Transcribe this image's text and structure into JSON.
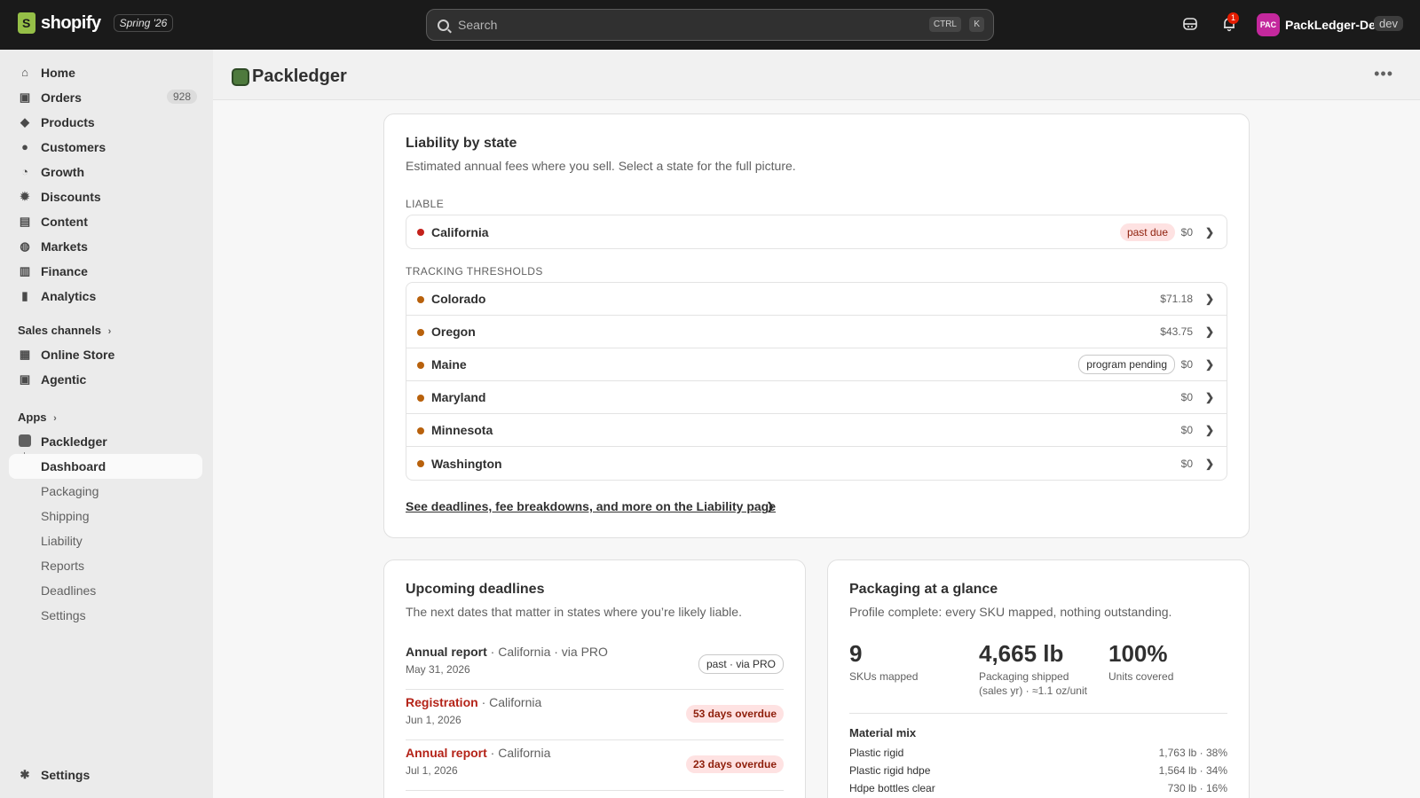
{
  "topbar": {
    "brand": "shopify",
    "season": "Spring '26",
    "search_placeholder": "Search",
    "shortcut_ctrl": "CTRL",
    "shortcut_k": "K",
    "notification_count": "1",
    "avatar_initials": "PAC",
    "store_name": "PackLedger-Dev",
    "env_tag": "dev"
  },
  "sidebar": {
    "items": [
      {
        "label": "Home",
        "icon": "home-icon"
      },
      {
        "label": "Orders",
        "icon": "orders-icon",
        "count": "928"
      },
      {
        "label": "Products",
        "icon": "tag-icon"
      },
      {
        "label": "Customers",
        "icon": "person-icon"
      },
      {
        "label": "Growth",
        "icon": "growth-icon"
      },
      {
        "label": "Discounts",
        "icon": "discount-icon"
      },
      {
        "label": "Content",
        "icon": "content-icon"
      },
      {
        "label": "Markets",
        "icon": "globe-icon"
      },
      {
        "label": "Finance",
        "icon": "bank-icon"
      },
      {
        "label": "Analytics",
        "icon": "bar-chart-icon"
      }
    ],
    "sales_channels_label": "Sales channels",
    "channels": [
      {
        "label": "Online Store",
        "icon": "store-icon"
      },
      {
        "label": "Agentic",
        "icon": "agentic-icon"
      }
    ],
    "apps_label": "Apps",
    "app_name": "Packledger",
    "app_pages": [
      "Dashboard",
      "Packaging",
      "Shipping",
      "Liability",
      "Reports",
      "Deadlines",
      "Settings"
    ],
    "settings_label": "Settings"
  },
  "page": {
    "title": "Packledger"
  },
  "liability": {
    "title": "Liability by state",
    "subtitle": "Estimated annual fees where you sell. Select a state for the full picture.",
    "liable_label": "LIABLE",
    "liable_states": [
      {
        "name": "California",
        "badge": "past due",
        "amount": "$0",
        "dot_color": "#c4211b"
      }
    ],
    "tracking_label": "TRACKING THRESHOLDS",
    "tracking_states": [
      {
        "name": "Colorado",
        "badge": "",
        "amount": "$71.18",
        "dot_color": "#b8610c"
      },
      {
        "name": "Oregon",
        "badge": "",
        "amount": "$43.75",
        "dot_color": "#b8610c"
      },
      {
        "name": "Maine",
        "badge": "program pending",
        "amount": "$0",
        "dot_color": "#b8610c"
      },
      {
        "name": "Maryland",
        "badge": "",
        "amount": "$0",
        "dot_color": "#b8610c"
      },
      {
        "name": "Minnesota",
        "badge": "",
        "amount": "$0",
        "dot_color": "#b8610c"
      },
      {
        "name": "Washington",
        "badge": "",
        "amount": "$0",
        "dot_color": "#b8610c"
      }
    ],
    "link_text": "See deadlines, fee breakdowns, and more on the Liability page"
  },
  "deadlines": {
    "title": "Upcoming deadlines",
    "subtitle": "The next dates that matter in states where you’re likely liable.",
    "items": [
      {
        "type": "Annual report",
        "detail": " · California · via PRO",
        "date": "May 31, 2026",
        "badge": "past · via PRO",
        "overdue": false
      },
      {
        "type": "Registration",
        "detail": " · California",
        "date": "Jun 1, 2026",
        "badge": "53 days overdue",
        "overdue": true
      },
      {
        "type": "Annual report",
        "detail": " · California",
        "date": "Jul 1, 2026",
        "badge": "23 days overdue",
        "overdue": true
      }
    ]
  },
  "packaging": {
    "title": "Packaging at a glance",
    "subtitle": "Profile complete: every SKU mapped, nothing outstanding.",
    "stats": [
      {
        "value": "9",
        "label": "SKUs mapped",
        "label2": ""
      },
      {
        "value": "4,665 lb",
        "label": "Packaging shipped",
        "label2": "(sales yr) · ≈1.1 oz/unit"
      },
      {
        "value": "100%",
        "label": "Units covered",
        "label2": ""
      }
    ],
    "mix_title": "Material mix",
    "mix": [
      {
        "name": "Plastic rigid",
        "value": "1,763 lb · 38%"
      },
      {
        "name": "Plastic rigid hdpe",
        "value": "1,564 lb · 34%"
      },
      {
        "name": "Hdpe bottles clear",
        "value": "730 lb · 16%"
      }
    ]
  },
  "colors": {
    "topbar": "#1a1a1a",
    "sidebar": "#ebebeb",
    "danger": "#b42318",
    "brand_green": "#95bf47"
  }
}
